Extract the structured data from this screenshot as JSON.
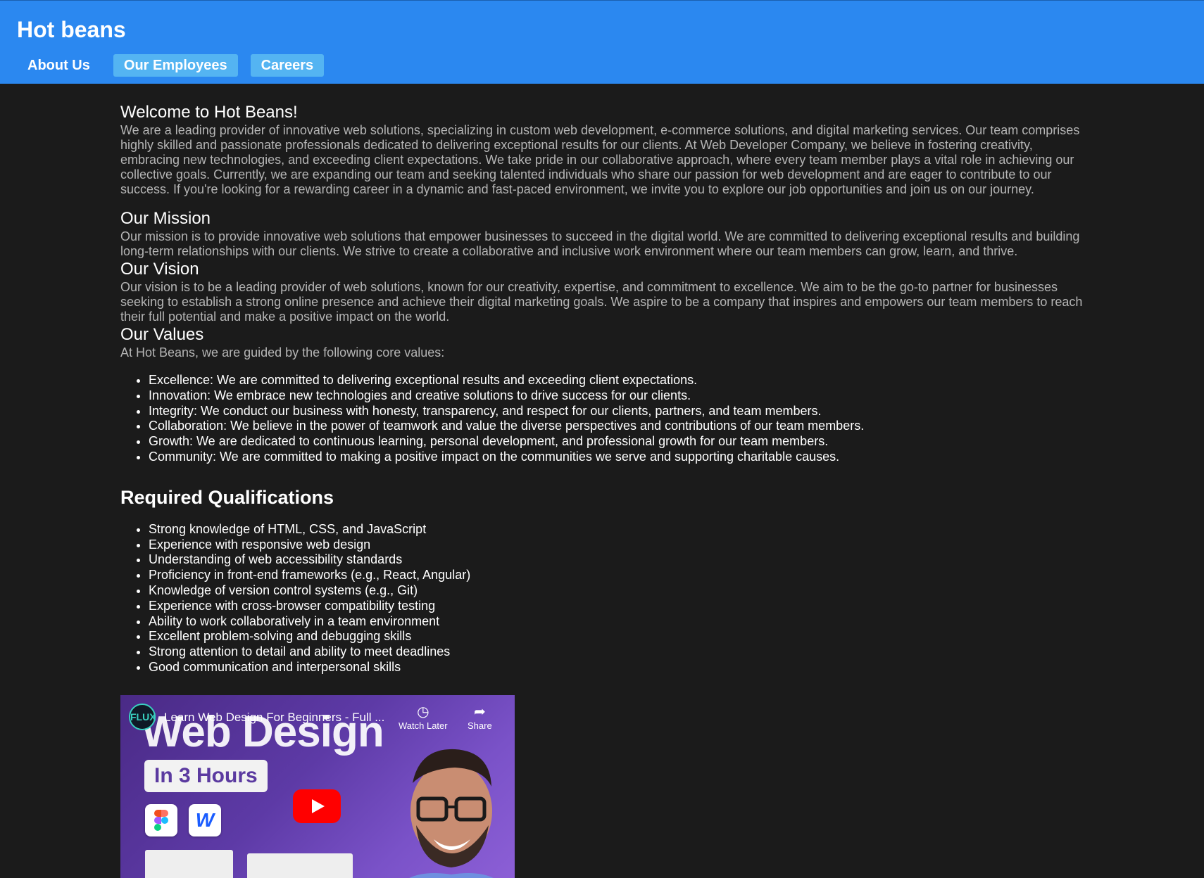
{
  "header": {
    "site_title": "Hot beans",
    "nav": [
      {
        "label": "About Us"
      },
      {
        "label": "Our Employees"
      },
      {
        "label": "Careers"
      }
    ]
  },
  "main": {
    "welcome": {
      "title": "Welcome to Hot Beans!",
      "text": "We are a leading provider of innovative web solutions, specializing in custom web development, e-commerce solutions, and digital marketing services. Our team comprises highly skilled and passionate professionals dedicated to delivering exceptional results for our clients. At Web Developer Company, we believe in fostering creativity, embracing new technologies, and exceeding client expectations. We take pride in our collaborative approach, where every team member plays a vital role in achieving our collective goals. Currently, we are expanding our team and seeking talented individuals who share our passion for web development and are eager to contribute to our success. If you're looking for a rewarding career in a dynamic and fast-paced environment, we invite you to explore our job opportunities and join us on our journey."
    },
    "mission": {
      "title": "Our Mission",
      "text": "Our mission is to provide innovative web solutions that empower businesses to succeed in the digital world. We are committed to delivering exceptional results and building long-term relationships with our clients. We strive to create a collaborative and inclusive work environment where our team members can grow, learn, and thrive."
    },
    "vision": {
      "title": "Our Vision",
      "text": "Our vision is to be a leading provider of web solutions, known for our creativity, expertise, and commitment to excellence. We aim to be the go-to partner for businesses seeking to establish a strong online presence and achieve their digital marketing goals. We aspire to be a company that inspires and empowers our team members to reach their full potential and make a positive impact on the world."
    },
    "values": {
      "title": "Our Values",
      "intro": "At Hot Beans, we are guided by the following core values:",
      "items": [
        "Excellence: We are committed to delivering exceptional results and exceeding client expectations.",
        "Innovation: We embrace new technologies and creative solutions to drive success for our clients.",
        "Integrity: We conduct our business with honesty, transparency, and respect for our clients, partners, and team members.",
        "Collaboration: We believe in the power of teamwork and value the diverse perspectives and contributions of our team members.",
        "Growth: We are dedicated to continuous learning, personal development, and professional growth for our team members.",
        "Community: We are committed to making a positive impact on the communities we serve and supporting charitable causes."
      ]
    },
    "qualifications": {
      "title": "Required Qualifications",
      "items": [
        "Strong knowledge of HTML, CSS, and JavaScript",
        "Experience with responsive web design",
        "Understanding of web accessibility standards",
        "Proficiency in front-end frameworks (e.g., React, Angular)",
        "Knowledge of version control systems (e.g., Git)",
        "Experience with cross-browser compatibility testing",
        "Ability to work collaboratively in a team environment",
        "Excellent problem-solving and debugging skills",
        "Strong attention to detail and ability to meet deadlines",
        "Good communication and interpersonal skills"
      ]
    },
    "video": {
      "title": "Learn Web Design For Beginners - Full ...",
      "thumbnail_heading": "Web Design",
      "thumbnail_badge": "In 3 Hours",
      "channel_logo_text": "FLUX",
      "watch_later_label": "Watch Later",
      "share_label": "Share"
    }
  },
  "colors": {
    "header_bg": "#2b88f0",
    "nav_highlight": "#54b4f2",
    "page_bg": "#1b1b1b",
    "play_button": "#ff0000"
  }
}
